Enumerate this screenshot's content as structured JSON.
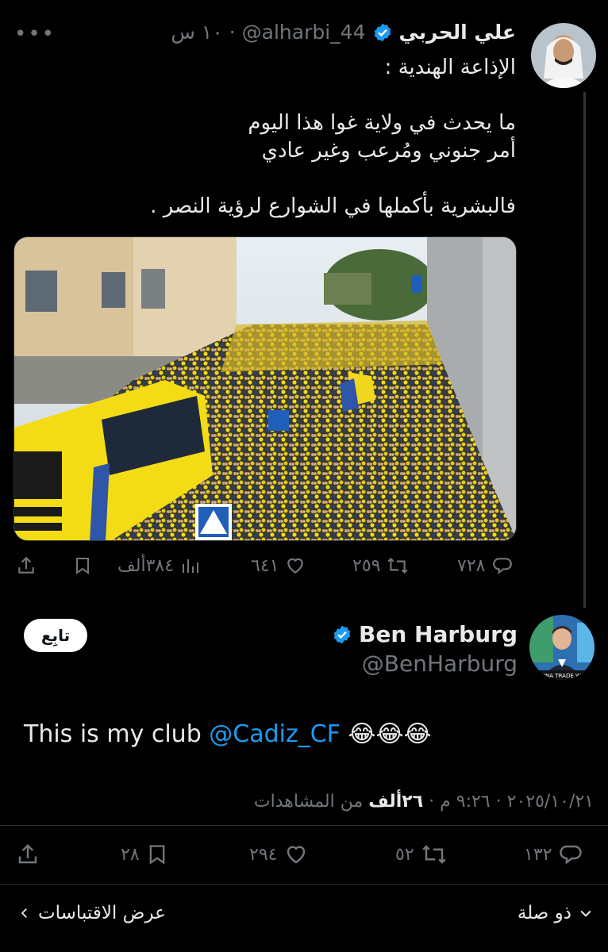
{
  "parent": {
    "name": "علي الحربي",
    "handle": "@alharbi_44",
    "separator": "·",
    "time": "١٠ س",
    "more": "•••",
    "text": "الإذاعة الهندية :\n\nما يحدث في ولاية غوا هذا اليوم\nأمر جنوني ومُرعب وغير عادي\n\nفالبشرية بأكملها في الشوارع لرؤية النصر .",
    "stats": {
      "replies": "٧٢٨",
      "reposts": "٢٥٩",
      "likes": "٦٤١",
      "views": "٣٨٤ألف"
    }
  },
  "main": {
    "name": "Ben Harburg",
    "handle": "@BenHarburg",
    "follow_label": "تابِع",
    "text_prefix": "This is my club ",
    "mention": "@Cadiz_CF",
    "emojis": "😂😂😂",
    "date": "٢٠٢٥/١٠/٢١",
    "time": "٩:٢٦ م",
    "views_count": "٢٦ألف",
    "views_label": "من المشاهدات",
    "stats": {
      "replies": "١٣٢",
      "reposts": "٥٢",
      "likes": "٢٩٤",
      "bookmarks": "٢٨"
    }
  },
  "footer": {
    "relevant": "ذو صلة",
    "quotes": "عرض الاقتباسات"
  },
  "colors": {
    "accent": "#1d9bf0",
    "muted": "#71767b",
    "bus": "#f3dc16"
  }
}
